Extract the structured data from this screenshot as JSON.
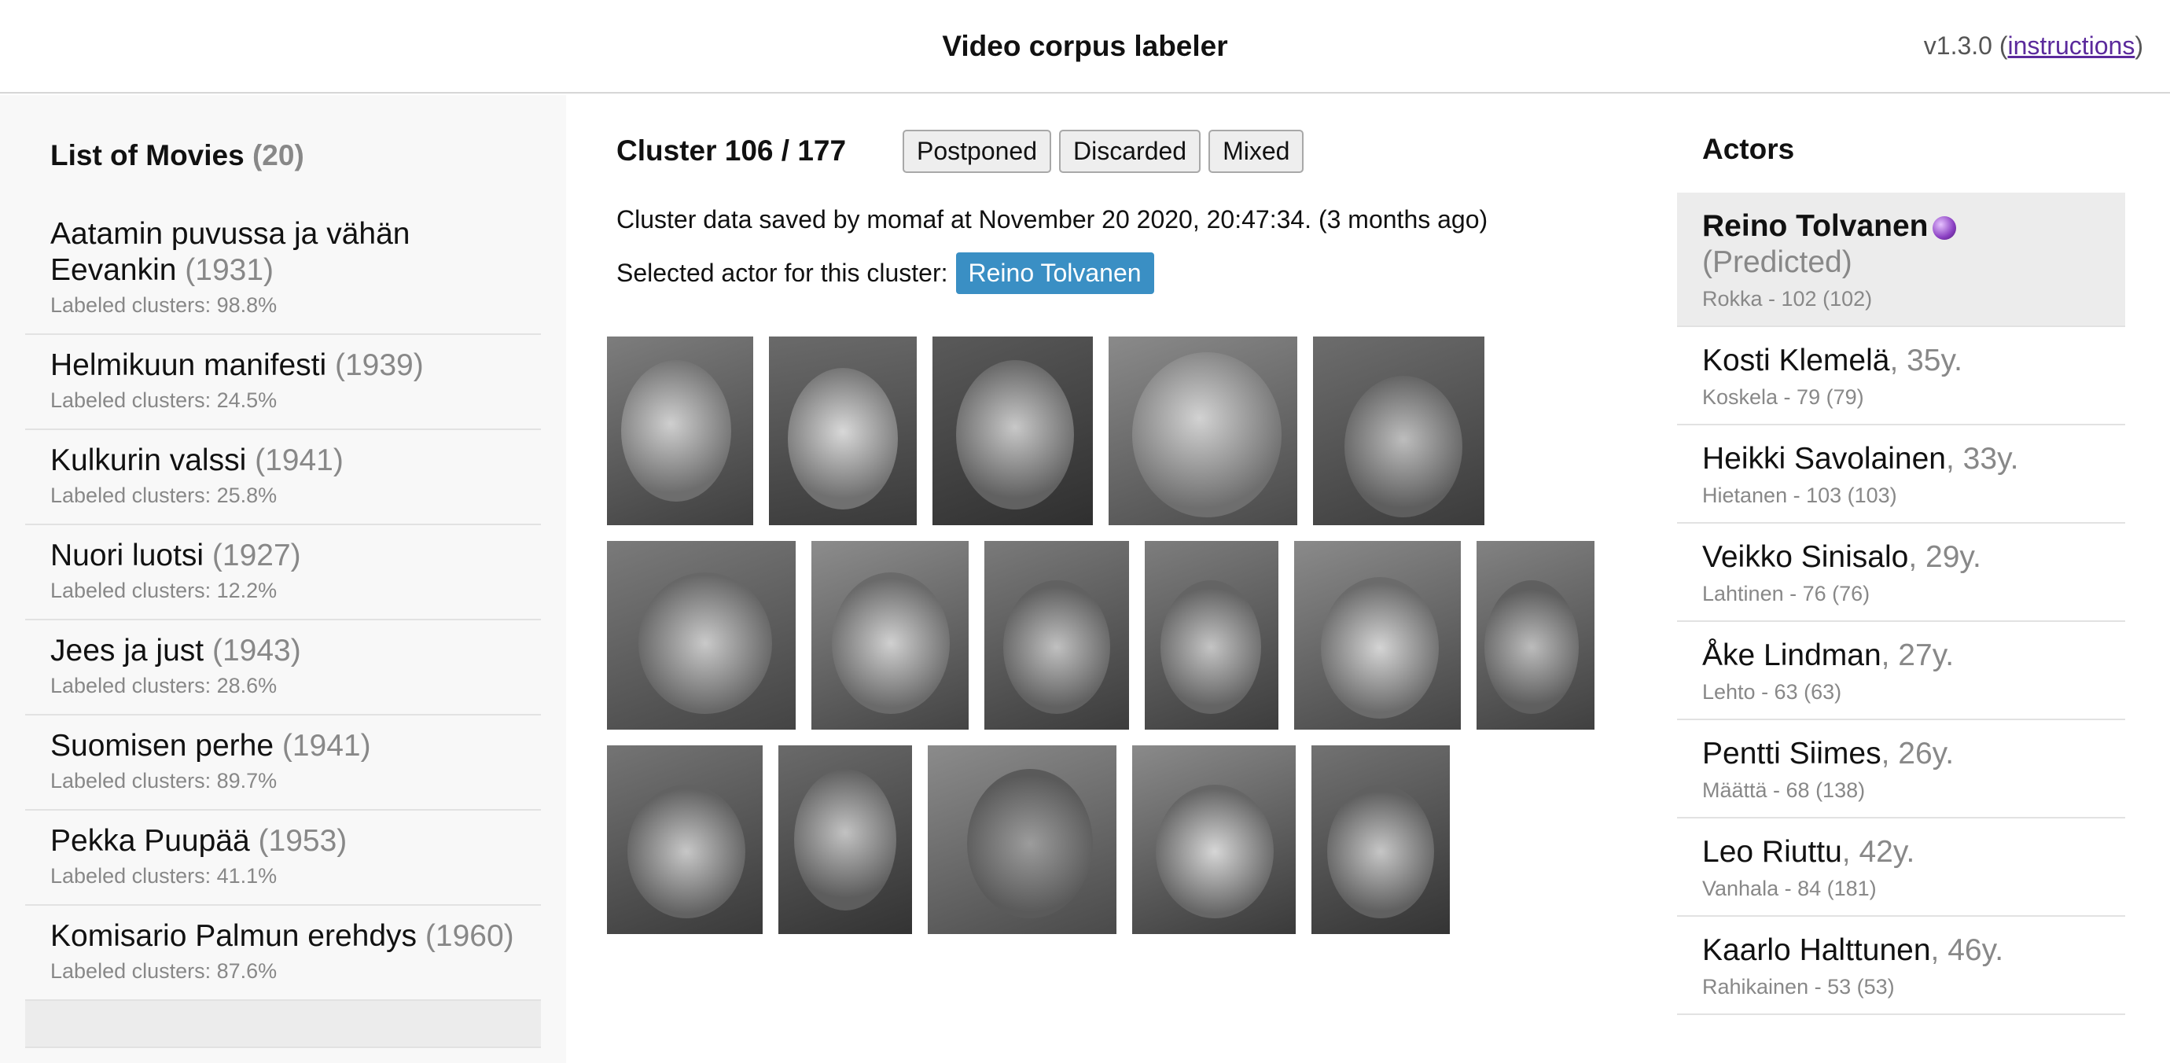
{
  "header": {
    "title": "Video corpus labeler",
    "version_prefix": "v1.3.0 (",
    "instructions_link": "instructions",
    "version_suffix": ")"
  },
  "movies": {
    "title": "List of Movies",
    "count": "(20)",
    "items": [
      {
        "title": "Aatamin puvussa ja vähän Eevankin",
        "year": "(1931)",
        "stat": "Labeled clusters: 98.8%"
      },
      {
        "title": "Helmikuun manifesti",
        "year": "(1939)",
        "stat": "Labeled clusters: 24.5%"
      },
      {
        "title": "Kulkurin valssi",
        "year": "(1941)",
        "stat": "Labeled clusters: 25.8%"
      },
      {
        "title": "Nuori luotsi",
        "year": "(1927)",
        "stat": "Labeled clusters: 12.2%"
      },
      {
        "title": "Jees ja just",
        "year": "(1943)",
        "stat": "Labeled clusters: 28.6%"
      },
      {
        "title": "Suomisen perhe",
        "year": "(1941)",
        "stat": "Labeled clusters: 89.7%"
      },
      {
        "title": "Pekka Puupää",
        "year": "(1953)",
        "stat": "Labeled clusters: 41.1%"
      },
      {
        "title": "Komisario Palmun erehdys",
        "year": "(1960)",
        "stat": "Labeled clusters: 87.6%"
      }
    ]
  },
  "cluster": {
    "title": "Cluster 106 / 177",
    "buttons": {
      "postponed": "Postponed",
      "discarded": "Discarded",
      "mixed": "Mixed"
    },
    "saved_text": "Cluster data saved by momaf at November 20 2020, 20:47:34. (3 months ago)",
    "selected_label": "Selected actor for this cluster:",
    "selected_actor": "Reino Tolvanen"
  },
  "actors": {
    "title": "Actors",
    "items": [
      {
        "name": "Reino Tolvanen",
        "age": "",
        "predicted": "(Predicted)",
        "role": "Rokka - 102 (102)"
      },
      {
        "name": "Kosti Klemelä",
        "age": ", 35y.",
        "role": "Koskela - 79 (79)"
      },
      {
        "name": "Heikki Savolainen",
        "age": ", 33y.",
        "role": "Hietanen - 103 (103)"
      },
      {
        "name": "Veikko Sinisalo",
        "age": ", 29y.",
        "role": "Lahtinen - 76 (76)"
      },
      {
        "name": "Åke Lindman",
        "age": ", 27y.",
        "role": "Lehto - 63 (63)"
      },
      {
        "name": "Pentti Siimes",
        "age": ", 26y.",
        "role": "Määttä - 68 (138)"
      },
      {
        "name": "Leo Riuttu",
        "age": ", 42y.",
        "role": "Vanhala - 84 (181)"
      },
      {
        "name": "Kaarlo Halttunen",
        "age": ", 46y.",
        "role": "Rahikainen - 53 (53)"
      }
    ]
  }
}
